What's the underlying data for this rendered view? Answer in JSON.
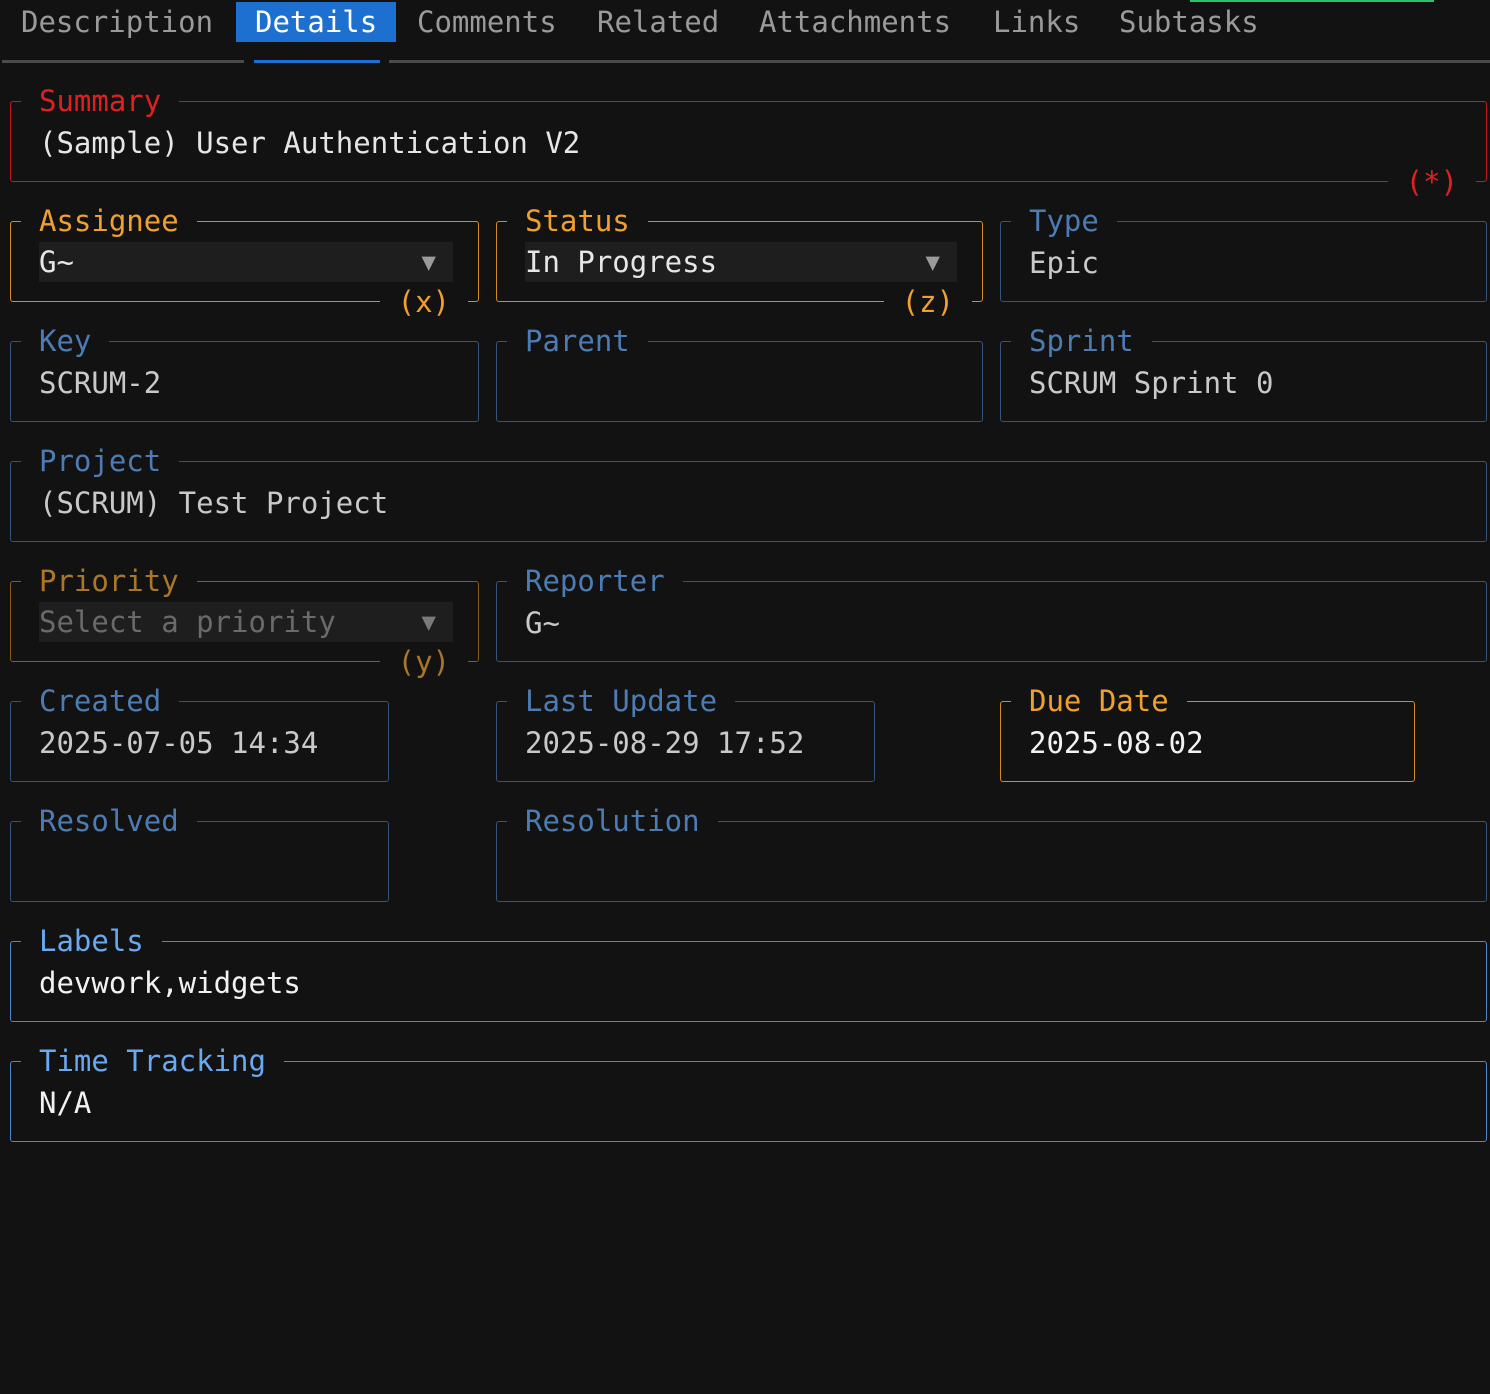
{
  "tabs": [
    {
      "label": "Description",
      "active": false
    },
    {
      "label": "Details",
      "active": true
    },
    {
      "label": "Comments",
      "active": false
    },
    {
      "label": "Related",
      "active": false
    },
    {
      "label": "Attachments",
      "active": false
    },
    {
      "label": "Links",
      "active": false
    },
    {
      "label": "Subtasks",
      "active": false
    }
  ],
  "summary": {
    "label": "Summary",
    "value": "(Sample) User Authentication V2",
    "hint": "(*)"
  },
  "assignee": {
    "label": "Assignee",
    "value": "G~",
    "caret": "▼",
    "hint": "(x)"
  },
  "status": {
    "label": "Status",
    "value": "In Progress",
    "caret": "▼",
    "hint": "(z)"
  },
  "type": {
    "label": "Type",
    "value": "Epic"
  },
  "key": {
    "label": "Key",
    "value": "SCRUM-2"
  },
  "parent": {
    "label": "Parent",
    "value": ""
  },
  "sprint": {
    "label": "Sprint",
    "value": "SCRUM Sprint 0"
  },
  "project": {
    "label": "Project",
    "value": "(SCRUM) Test Project"
  },
  "priority": {
    "label": "Priority",
    "placeholder": "Select a priority",
    "caret": "▼",
    "hint": "(y)"
  },
  "reporter": {
    "label": "Reporter",
    "value": "G~"
  },
  "created": {
    "label": "Created",
    "value": "2025-07-05 14:34"
  },
  "last_update": {
    "label": "Last Update",
    "value": "2025-08-29 17:52"
  },
  "due_date": {
    "label": "Due Date",
    "value": "2025-08-02"
  },
  "resolved": {
    "label": "Resolved",
    "value": ""
  },
  "resolution": {
    "label": "Resolution",
    "value": ""
  },
  "labels": {
    "label": "Labels",
    "value": "devwork,widgets"
  },
  "time_tracking": {
    "label": "Time Tracking",
    "value": "N/A"
  },
  "colors": {
    "background": "#121212",
    "accent_tab": "#1d6fd0",
    "required": "#e02020",
    "editable": "#f0a030",
    "field_border": "#34547e",
    "section_label": "#6aa8ef"
  }
}
